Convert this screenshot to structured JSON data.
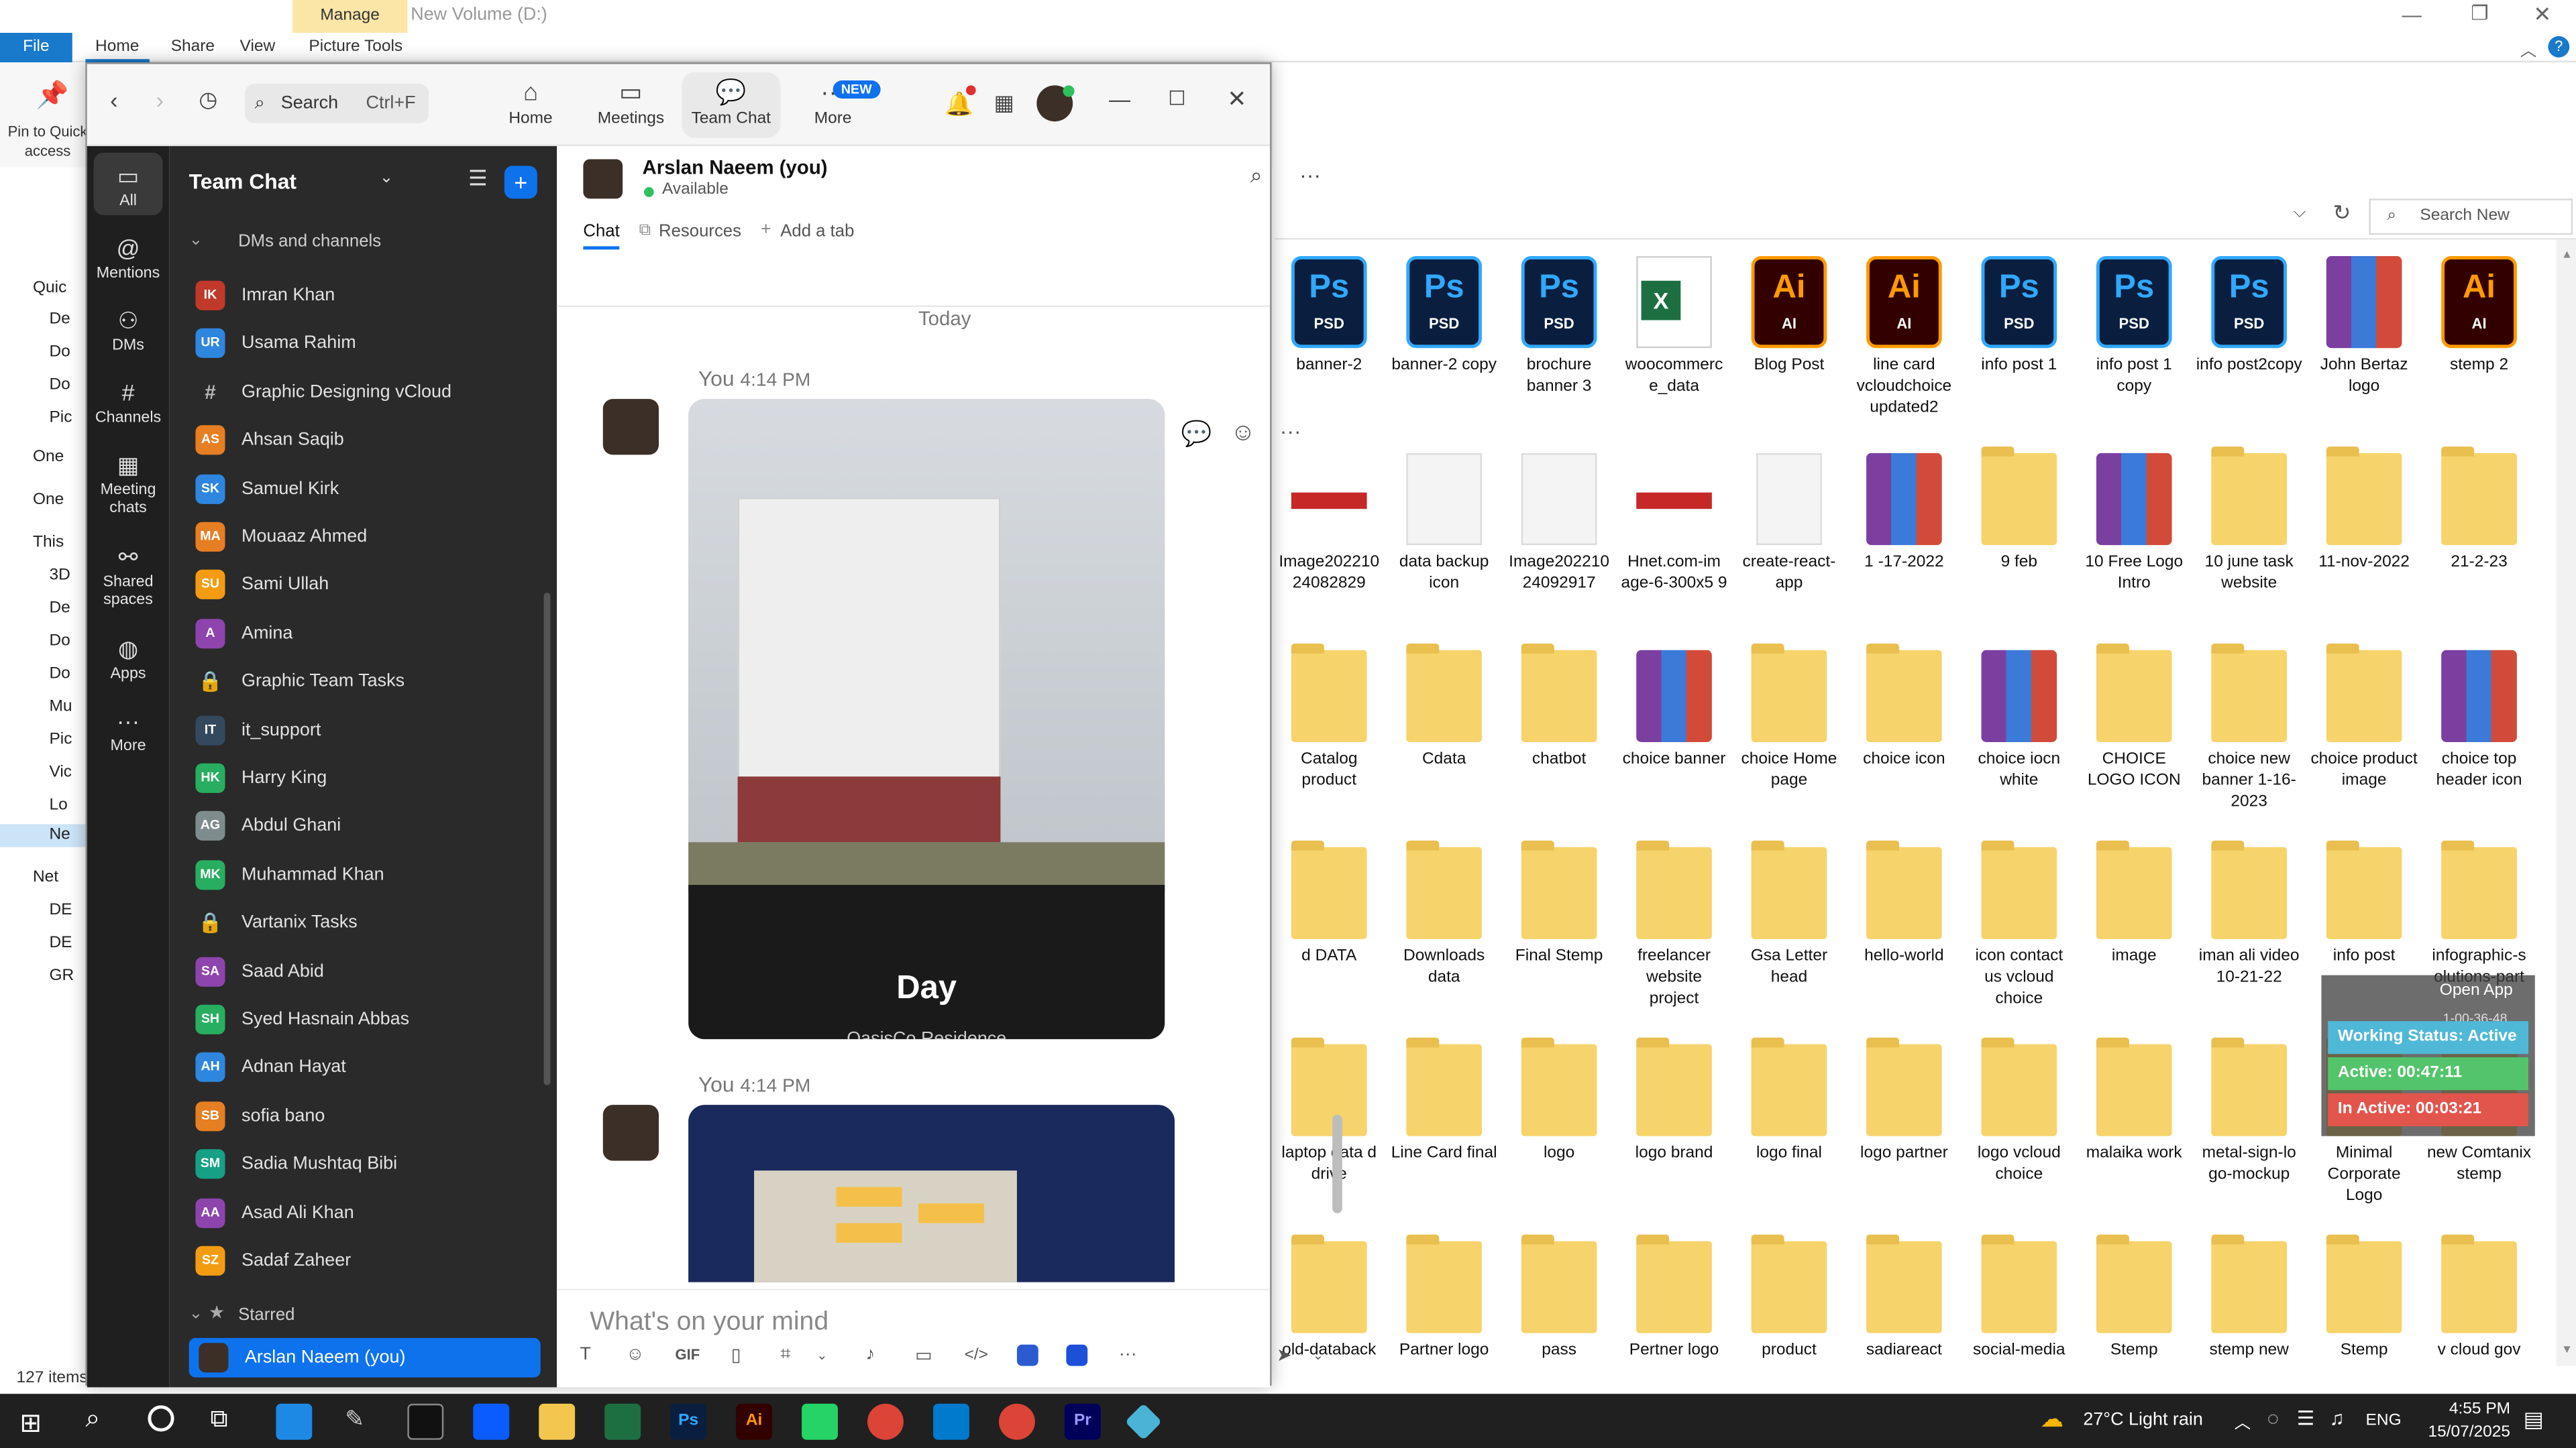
{
  "explorer": {
    "title": "New Volume (D:)",
    "tabs": [
      "File",
      "Home",
      "Share",
      "View"
    ],
    "context_group": "Manage",
    "context_tab": "Picture Tools",
    "pin_label": "Pin to Quick access",
    "search_placeholder": "Search New Volum...",
    "status": "127 items",
    "nav_items": [
      "Quic",
      "De",
      "Do",
      "Do",
      "Pic",
      "One",
      "One",
      "This",
      "3D",
      "De",
      "Do",
      "Do",
      "Mu",
      "Pic",
      "Vic",
      "Lo",
      "Ne",
      "Net",
      "DE",
      "DE",
      "GR"
    ],
    "files": [
      {
        "label": "banner-2",
        "kind": "psd"
      },
      {
        "label": "banner-2 copy",
        "kind": "psd"
      },
      {
        "label": "brochure banner 3",
        "kind": "psd"
      },
      {
        "label": "woocommerc e_data",
        "kind": "xlsx"
      },
      {
        "label": "Blog Post",
        "kind": "ai"
      },
      {
        "label": "line card vcloudchoice updated2",
        "kind": "ai"
      },
      {
        "label": "info post 1",
        "kind": "psd"
      },
      {
        "label": "info post 1 copy",
        "kind": "psd"
      },
      {
        "label": "info post2copy",
        "kind": "psd"
      },
      {
        "label": "John Bertaz logo",
        "kind": "rar"
      },
      {
        "label": "stemp 2",
        "kind": "ai"
      },
      {
        "label": "Image202210 24082829",
        "kind": "img"
      },
      {
        "label": "data backup icon",
        "kind": "blank"
      },
      {
        "label": "Image202210 24092917",
        "kind": "blank"
      },
      {
        "label": "Hnet.com-im age-6-300x5 9",
        "kind": "img"
      },
      {
        "label": "create-react-app",
        "kind": "doc"
      },
      {
        "label": "1 -17-2022",
        "kind": "rar"
      },
      {
        "label": "9 feb",
        "kind": "folder"
      },
      {
        "label": "10 Free Logo Intro",
        "kind": "rar"
      },
      {
        "label": "10 june task website",
        "kind": "folder"
      },
      {
        "label": "11-nov-2022",
        "kind": "folder"
      },
      {
        "label": "21-2-23",
        "kind": "folder"
      },
      {
        "label": "Catalog product",
        "kind": "folder"
      },
      {
        "label": "Cdata",
        "kind": "folder"
      },
      {
        "label": "chatbot",
        "kind": "folder"
      },
      {
        "label": "choice banner",
        "kind": "rar"
      },
      {
        "label": "choice Home page",
        "kind": "folder"
      },
      {
        "label": "choice icon",
        "kind": "folder"
      },
      {
        "label": "choice iocn white",
        "kind": "rar"
      },
      {
        "label": "CHOICE LOGO ICON",
        "kind": "folder"
      },
      {
        "label": "choice new banner 1-16-2023",
        "kind": "folder"
      },
      {
        "label": "choice product image",
        "kind": "folder"
      },
      {
        "label": "choice top header icon",
        "kind": "rar"
      },
      {
        "label": "d DATA",
        "kind": "folder"
      },
      {
        "label": "Downloads data",
        "kind": "folder"
      },
      {
        "label": "Final Stemp",
        "kind": "folder"
      },
      {
        "label": "freelancer website project",
        "kind": "folder"
      },
      {
        "label": "Gsa Letter head",
        "kind": "folder"
      },
      {
        "label": "hello-world",
        "kind": "folder"
      },
      {
        "label": "icon contact us vcloud choice",
        "kind": "folder"
      },
      {
        "label": "image",
        "kind": "folder"
      },
      {
        "label": "iman ali video 10-21-22",
        "kind": "folder"
      },
      {
        "label": "info post",
        "kind": "folder"
      },
      {
        "label": "infographic-s olutions-part",
        "kind": "folder"
      },
      {
        "label": "laptop data d drive",
        "kind": "folder"
      },
      {
        "label": "Line Card final",
        "kind": "folder"
      },
      {
        "label": "logo",
        "kind": "folder"
      },
      {
        "label": "logo brand",
        "kind": "folder"
      },
      {
        "label": "logo final",
        "kind": "folder"
      },
      {
        "label": "logo partner",
        "kind": "folder"
      },
      {
        "label": "logo vcloud choice",
        "kind": "folder"
      },
      {
        "label": "malaika work",
        "kind": "folder"
      },
      {
        "label": "metal-sign-lo go-mockup",
        "kind": "folder"
      },
      {
        "label": "Minimal Corporate Logo",
        "kind": "folder"
      },
      {
        "label": "new Comtanix stemp",
        "kind": "folder"
      },
      {
        "label": "old-databack",
        "kind": "folder"
      },
      {
        "label": "Partner logo",
        "kind": "folder"
      },
      {
        "label": "pass",
        "kind": "folder"
      },
      {
        "label": "Pertner logo",
        "kind": "folder"
      },
      {
        "label": "product",
        "kind": "folder"
      },
      {
        "label": "sadiareact",
        "kind": "folder"
      },
      {
        "label": "social-media",
        "kind": "folder"
      },
      {
        "label": "Stemp",
        "kind": "folder"
      },
      {
        "label": "stemp new",
        "kind": "folder"
      },
      {
        "label": "Stemp",
        "kind": "folder"
      },
      {
        "label": "v cloud gov",
        "kind": "folder"
      }
    ]
  },
  "tracker": {
    "open_app": "Open App",
    "time_partial": "1-00-36-48",
    "working": "Working Status: Active",
    "active": "Active: 00:47:11",
    "inactive": "In Active: 00:03:21"
  },
  "zoom": {
    "search": "Search",
    "search_shortcut": "Ctrl+F",
    "nav": [
      "Home",
      "Meetings",
      "Team Chat",
      "More"
    ],
    "new_badge": "NEW",
    "rail": [
      "All",
      "Mentions",
      "DMs",
      "Channels",
      "Meeting chats",
      "Shared spaces",
      "Apps",
      "More"
    ],
    "panel_title": "Team Chat",
    "section": "DMs and channels",
    "starred": "Starred",
    "contacts": [
      {
        "name": "Imran Khan",
        "initials": "IK",
        "color": "#c0392b"
      },
      {
        "name": "Usama Rahim",
        "initials": "UR",
        "color": "#2e86de"
      },
      {
        "name": "Graphic Designing vCloud",
        "initials": "#",
        "color": "#2a2a2a"
      },
      {
        "name": "Ahsan Saqib",
        "initials": "AS",
        "color": "#e67e22"
      },
      {
        "name": "Samuel Kirk",
        "initials": "SK",
        "color": "#2e86de"
      },
      {
        "name": "Mouaaz Ahmed",
        "initials": "MA",
        "color": "#e67e22"
      },
      {
        "name": "Sami Ullah",
        "initials": "SU",
        "color": "#f39c12"
      },
      {
        "name": "Amina",
        "initials": "A",
        "color": "#8e44ad"
      },
      {
        "name": "Graphic Team Tasks",
        "initials": "🔒",
        "color": "#2a2a2a"
      },
      {
        "name": "it_support",
        "initials": "IT",
        "color": "#34495e"
      },
      {
        "name": "Harry King",
        "initials": "HK",
        "color": "#27ae60"
      },
      {
        "name": "Abdul Ghani",
        "initials": "AG",
        "color": "#7f8c8d"
      },
      {
        "name": "Muhammad Khan",
        "initials": "MK",
        "color": "#27ae60"
      },
      {
        "name": "Vartanix Tasks",
        "initials": "🔒",
        "color": "#2a2a2a"
      },
      {
        "name": "Saad Abid",
        "initials": "SA",
        "color": "#8e44ad"
      },
      {
        "name": "Syed Hasnain Abbas",
        "initials": "SH",
        "color": "#27ae60"
      },
      {
        "name": "Adnan Hayat",
        "initials": "AH",
        "color": "#2e86de"
      },
      {
        "name": "sofia bano",
        "initials": "SB",
        "color": "#e67e22"
      },
      {
        "name": "Sadia Mushtaq Bibi",
        "initials": "SM",
        "color": "#16a085"
      },
      {
        "name": "Asad Ali Khan",
        "initials": "AA",
        "color": "#8e44ad"
      },
      {
        "name": "Sadaf Zaheer",
        "initials": "SZ",
        "color": "#f39c12"
      }
    ],
    "starred_item": "Arslan Naeem (you)",
    "chat_name": "Arslan Naeem (you)",
    "presence": "Available",
    "chat_tabs": [
      "Chat",
      "Resources",
      "Add a tab"
    ],
    "day_divider": "Today",
    "msg1_sender": "You",
    "msg1_time": "4:14 PM",
    "msg1_caption": "Day",
    "msg1_subcaption": "OasisCo Residence",
    "msg2_sender": "You",
    "msg2_time": "4:14 PM",
    "composer_placeholder": "What's on your mind"
  },
  "taskbar": {
    "weather": "27°C Light rain",
    "lang": "ENG",
    "time": "4:55 PM",
    "date": "15/07/2025"
  },
  "colors": {
    "zoom_blue": "#0e72ed",
    "rail_bg": "#1f1f1f",
    "list_bg": "#2a2a2a",
    "selected": "#0e72ed",
    "taskbar": "#202020"
  }
}
